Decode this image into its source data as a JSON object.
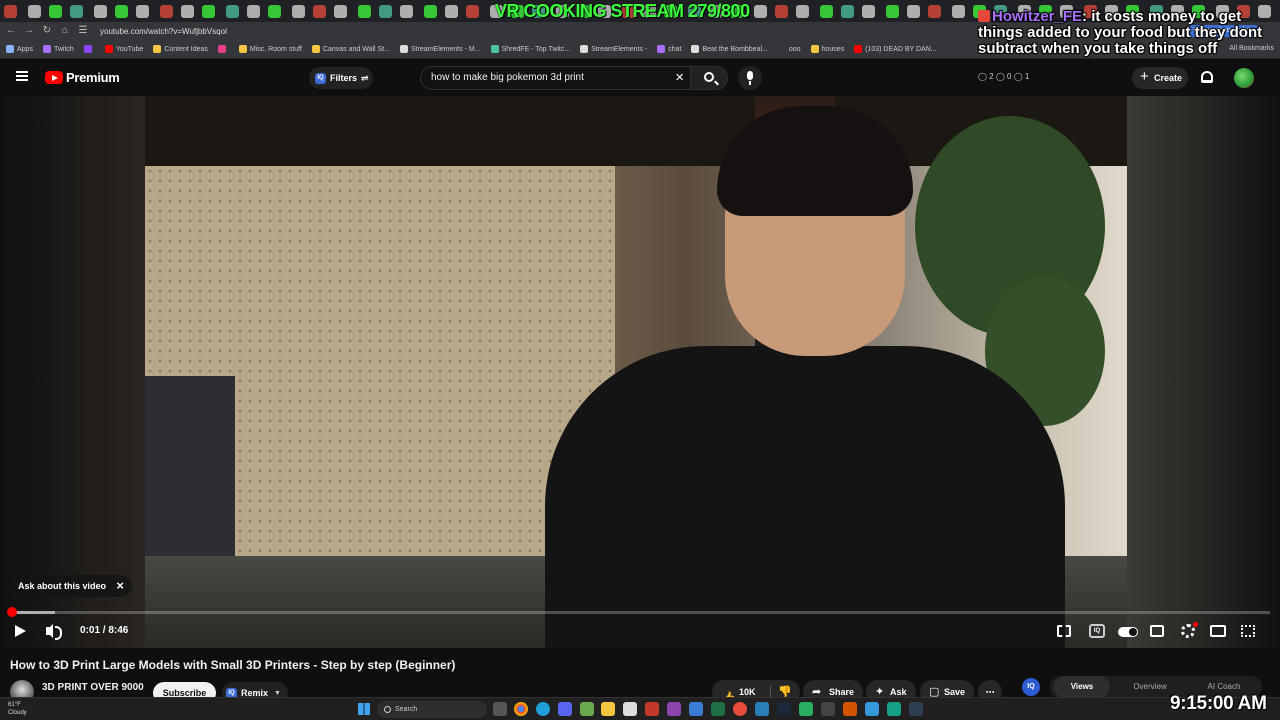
{
  "stream_overlay": {
    "title": "VR COOKING STREAM 279/800",
    "chat": {
      "username": "Howitzer_FE",
      "separator": ": ",
      "message": "it costs money to get things added to your food but they dont subtract when you take things off"
    },
    "clock": "9:15:00 AM"
  },
  "browser": {
    "url": "youtube.com/watch?v=WufjbbVsqoI",
    "relaunch_label": "Relaunch to update",
    "bookmarks": [
      {
        "label": "Apps",
        "color": "#8ab4f8"
      },
      {
        "label": "Twitch",
        "color": "#a970ff"
      },
      {
        "label": "",
        "color": "#9146ff"
      },
      {
        "label": "YouTube",
        "color": "#ff0000"
      },
      {
        "label": "Content Ideas",
        "color": "#f4c542"
      },
      {
        "label": "",
        "color": "#e83e8c"
      },
      {
        "label": "Misc. Room stuff",
        "color": "#f4c542"
      },
      {
        "label": "Canvas and Wall St...",
        "color": "#f4c542"
      },
      {
        "label": "StreamElements - M...",
        "color": "#dddddd"
      },
      {
        "label": "ShredFE - Top Twitc...",
        "color": "#4fc3a1"
      },
      {
        "label": "StreamElements -",
        "color": "#dddddd"
      },
      {
        "label": "chat",
        "color": "#a970ff"
      },
      {
        "label": "Beat the Bombbeal...",
        "color": "#dddddd"
      },
      {
        "label": "ooo",
        "color": "#35363a"
      },
      {
        "label": "houses",
        "color": "#f4c542"
      },
      {
        "label": "(103) DEAD BY DAN...",
        "color": "#ff0000"
      }
    ],
    "all_bookmarks_label": "All Bookmarks"
  },
  "youtube": {
    "brand": "Premium",
    "filters_label": "Filters",
    "iq_label": "IQ",
    "search_query": "how to make big pokemon 3d print",
    "create_label": "Create",
    "ext_counts": "◯ 2  ◯ 0  ◯ 1"
  },
  "player": {
    "ask_chip_label": "Ask about this video",
    "time_display": "0:01 / 8:46",
    "progress_fraction": 0.0019,
    "buffer_fraction": 0.036
  },
  "video": {
    "title": "How to 3D Print Large Models with Small 3D Printers - Step by step (Beginner)",
    "channel_name": "3D PRINT OVER 9000",
    "subscribe_label": "Subscribe",
    "remix_label": "Remix",
    "like_count": "10K",
    "share_label": "Share",
    "ask_label": "Ask",
    "save_label": "Save",
    "side_tabs": [
      "Views",
      "Overview",
      "AI Coach"
    ]
  },
  "taskbar": {
    "weather_temp": "61°F",
    "weather_desc": "Cloudy",
    "search_label": "Search"
  }
}
